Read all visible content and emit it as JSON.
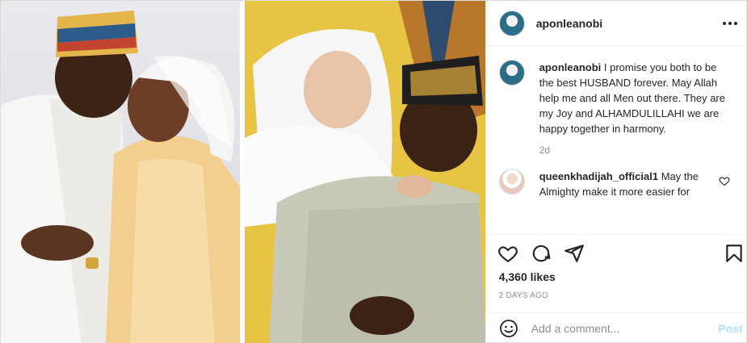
{
  "header": {
    "username": "aponleanobi"
  },
  "caption": {
    "username": "aponleanobi",
    "text": "I promise you both to be the best HUSBAND forever. May Allah help me and all Men out there. They are my Joy and ALHAMDULILLAHI we are happy together in harmony.",
    "time": "2d"
  },
  "comments": [
    {
      "username": "queenkhadijah_official1",
      "text": "May the Almighty make it more easier for"
    }
  ],
  "icons": {
    "like": "heart-icon",
    "comment": "comment-icon",
    "share": "share-icon",
    "save": "bookmark-icon",
    "more": "more-icon",
    "emoji": "emoji-icon"
  },
  "stats": {
    "likes": "4,360 likes",
    "date": "2 DAYS AGO"
  },
  "add_comment": {
    "placeholder": "Add a comment...",
    "post_label": "Post"
  },
  "colors": {
    "post_button_disabled": "#b2dffc",
    "border": "#dbdbdb",
    "muted_text": "#8e8e8e"
  }
}
